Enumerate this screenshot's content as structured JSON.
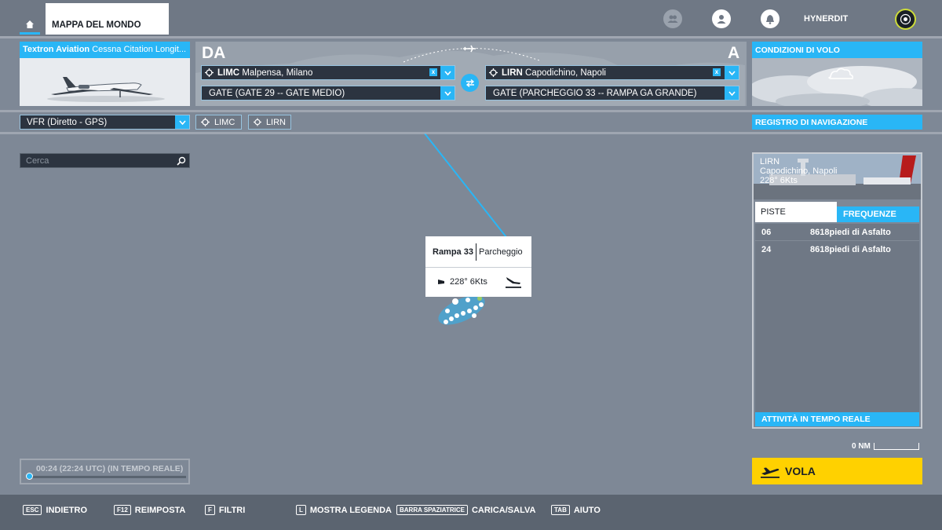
{
  "header": {
    "tab_label": "MAPPA DEL MONDO",
    "username": "HYNERDIT"
  },
  "aircraft": {
    "brand": "Textron Aviation",
    "model": "Cessna Citation Longit..."
  },
  "route": {
    "from_label": "DA",
    "to_label": "A",
    "departure": {
      "code": "LIMC",
      "name": "Malpensa, Milano",
      "gate": "GATE (GATE 29 -- GATE MEDIO)"
    },
    "arrival": {
      "code": "LIRN",
      "name": "Capodichino, Napoli",
      "gate": "GATE (PARCHEGGIO 33 -- RAMPA GA GRANDE)"
    },
    "clear_label": "x"
  },
  "conditions": {
    "title": "CONDIZIONI DI VOLO"
  },
  "flight_plan": {
    "type": "VFR (Diretto - GPS)",
    "waypoints": [
      "LIMC",
      "LIRN"
    ]
  },
  "navlog": {
    "label": "REGISTRO DI NAVIGAZIONE"
  },
  "search": {
    "placeholder": "Cerca"
  },
  "map_popup": {
    "stand": "Rampa 33",
    "stand_type": "Parcheggio",
    "wind": "228° 6Kts"
  },
  "airport_card": {
    "code": "LIRN",
    "name": "Capodichino, Napoli",
    "wind": "228° 6Kts",
    "tabs": [
      "PISTE",
      "FREQUENZE"
    ],
    "runways": [
      {
        "id": "06",
        "desc": "8618piedi di Asfalto"
      },
      {
        "id": "24",
        "desc": "8618piedi di Asfalto"
      }
    ],
    "live_label": "ATTIVITÀ IN TEMPO REALE"
  },
  "scale": {
    "label": "0 NM"
  },
  "time": {
    "label": "00:24 (22:24 UTC) (IN TEMPO REALE)"
  },
  "fly_button": {
    "label": "VOLA"
  },
  "bottom_bar": [
    {
      "key": "ESC",
      "label": "INDIETRO"
    },
    {
      "key": "F12",
      "label": "REIMPOSTA"
    },
    {
      "key": "F",
      "label": "FILTRI"
    },
    {
      "key": "L",
      "label": "MOSTRA LEGENDA"
    },
    {
      "key": "BARRA SPAZIATRICE",
      "label": "CARICA/SALVA"
    },
    {
      "key": "TAB",
      "label": "AIUTO"
    }
  ],
  "colors": {
    "accent": "#29b6f6",
    "fly": "#ffd100",
    "map": "#7e8896"
  }
}
